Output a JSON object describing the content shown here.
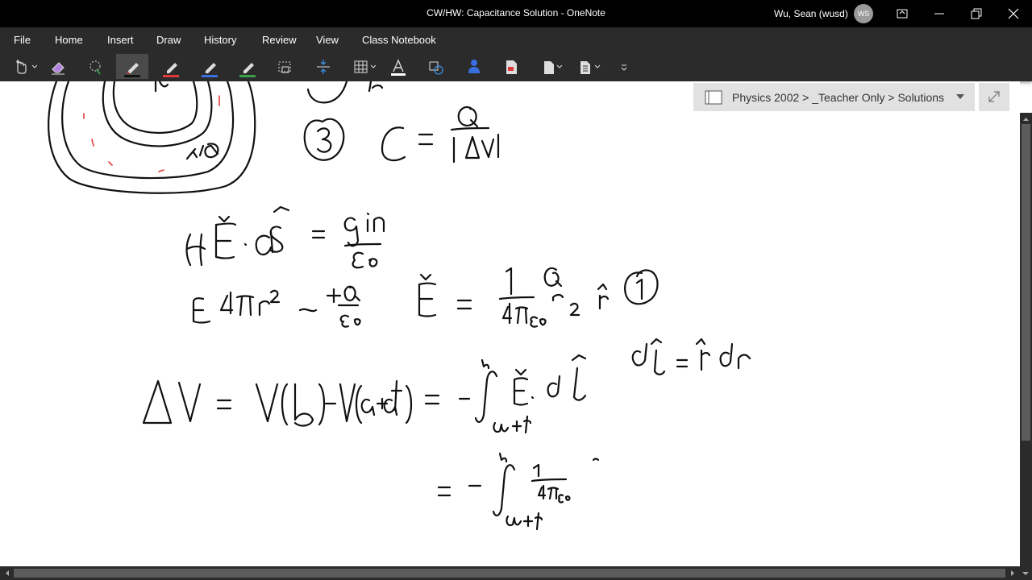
{
  "window": {
    "title": "CW/HW:  Capacitance Solution  -  OneNote",
    "user_name": "Wu, Sean (wusd)",
    "user_initials": "WS",
    "controls": [
      "ribbon-display-icon",
      "minimize-icon",
      "restore-icon",
      "close-icon"
    ]
  },
  "menu": {
    "items": [
      "File",
      "Home",
      "Insert",
      "Draw",
      "History",
      "Review",
      "View",
      "Class Notebook"
    ]
  },
  "toolbar": {
    "tools": [
      {
        "name": "touch-select-icon",
        "has_dropdown": true
      },
      {
        "name": "eraser-icon"
      },
      {
        "name": "lasso-select-icon"
      },
      {
        "name": "pen-black-icon",
        "color": "#111111",
        "active": true
      },
      {
        "name": "pen-red-icon",
        "color": "#e03a3a"
      },
      {
        "name": "pen-blue-icon",
        "color": "#3a6fe0"
      },
      {
        "name": "pen-green-icon",
        "color": "#3aa04a"
      },
      {
        "name": "screen-clip-icon"
      },
      {
        "name": "add-space-icon"
      },
      {
        "name": "table-icon",
        "has_dropdown": true
      },
      {
        "name": "font-color-icon"
      },
      {
        "name": "shapes-icon"
      },
      {
        "name": "person-icon"
      },
      {
        "name": "page-icon"
      },
      {
        "name": "insert-page-icon",
        "has_dropdown": true
      },
      {
        "name": "page-template-icon",
        "has_dropdown": true
      },
      {
        "name": "customize-toolbar-icon"
      }
    ],
    "accent_color": "#3a8de0"
  },
  "notebook": {
    "breadcrumb": "Physics 2002 > _Teacher Only > Solutions"
  },
  "colors": {
    "titlebar": "#000000",
    "chrome": "#2b2b2b",
    "canvas": "#ffffff",
    "notebook_bar": "#e1e1e1",
    "ink": "#111111",
    "red_ink": "#e03a3a"
  }
}
